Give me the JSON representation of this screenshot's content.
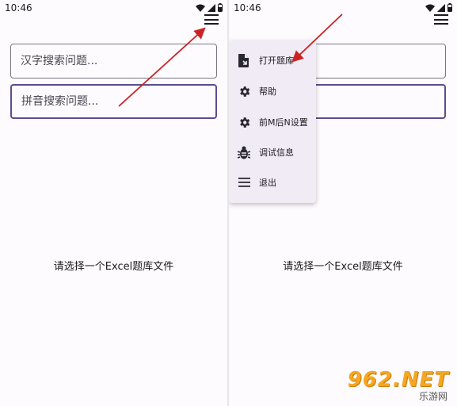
{
  "left_screen": {
    "status": {
      "time": "10:46"
    },
    "search_hanzi": {
      "placeholder": "汉字搜索问题..."
    },
    "search_pinyin": {
      "placeholder": "拼音搜索问题..."
    },
    "message": "请选择一个Excel题库文件"
  },
  "right_screen": {
    "status": {
      "time": "10:46"
    },
    "menu": {
      "items": [
        {
          "label": "打开题库",
          "icon": "file-open-icon"
        },
        {
          "label": "帮助",
          "icon": "gear-icon"
        },
        {
          "label": "前M后N设置",
          "icon": "gear-icon"
        },
        {
          "label": "调试信息",
          "icon": "bug-icon"
        },
        {
          "label": "退出",
          "icon": "menu-lines-icon"
        }
      ]
    },
    "message": "请选择一个Excel题库文件"
  },
  "watermark": {
    "main": "962.NET",
    "sub": "乐游网"
  },
  "colors": {
    "accent": "#5b4d8f",
    "arrow": "#cc2222",
    "menu_bg": "#f1ebf5",
    "watermark": "#f5a623"
  }
}
